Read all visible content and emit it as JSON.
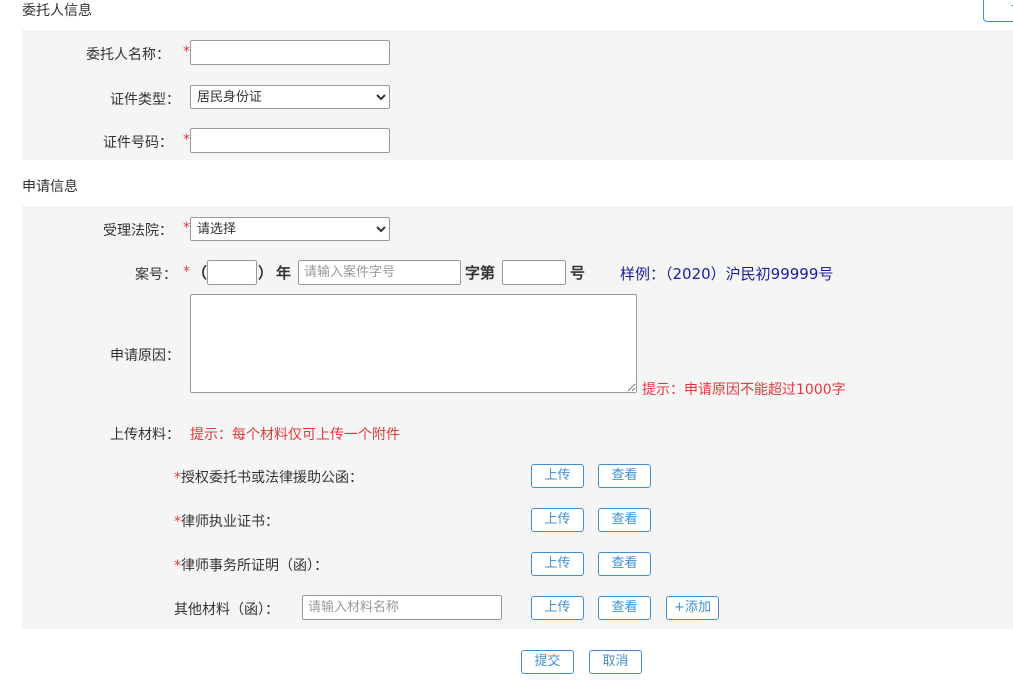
{
  "client_section": {
    "title": "委托人信息",
    "corner_button": "+",
    "name_label": "委托人名称：",
    "name_value": "",
    "id_type_label": "证件类型：",
    "id_type_selected": "居民身份证",
    "id_number_label": "证件号码：",
    "id_number_value": ""
  },
  "application_section": {
    "title": "申请信息",
    "court_label": "受理法院：",
    "court_selected": "请选择",
    "case_label": "案号：",
    "case_open_paren": "（",
    "case_close_paren": "）",
    "case_year_char": "年",
    "case_word_placeholder": "请输入案件字号",
    "case_word_char": "字第",
    "case_number_char": "号",
    "case_example": "样例：（2020）沪民初99999号",
    "reason_label": "申请原因：",
    "reason_hint": "提示：申请原因不能超过1000字",
    "upload_label": "上传材料：",
    "upload_hint": "提示：每个材料仅可上传一个附件",
    "materials": [
      {
        "required": true,
        "name": "授权委托书或法律援助公函："
      },
      {
        "required": true,
        "name": "律师执业证书："
      },
      {
        "required": true,
        "name": "律师事务所证明（函）："
      }
    ],
    "other_material_label": "其他材料（函）：",
    "other_material_placeholder": "请输入材料名称",
    "upload_button": "上传",
    "view_button": "查看",
    "add_button": "+添加"
  },
  "footer": {
    "submit_button": "提交",
    "cancel_button": "取消"
  },
  "required_mark": "*",
  "colors": {
    "accent": "#3f8fd2",
    "required": "#e4393c",
    "sample": "#1a1aa6",
    "panel_bg": "#f5f5f5"
  }
}
